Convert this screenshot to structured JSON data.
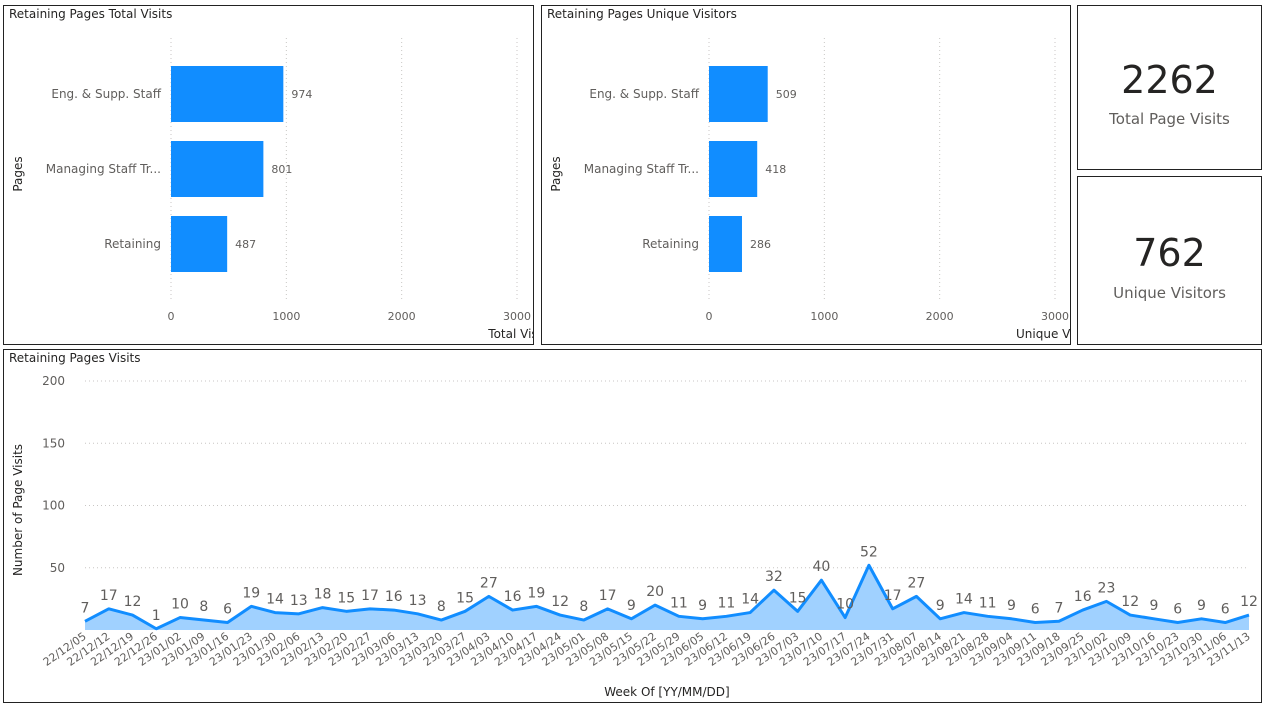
{
  "charts": [
    {
      "title": "Retaining Pages Total Visits",
      "chart_data": {
        "type": "bar",
        "orientation": "horizontal",
        "title": "Retaining Pages Total Visits",
        "categories": [
          "Eng. & Supp. Staff",
          "Managing Staff Tr...",
          "Retaining"
        ],
        "values": [
          974,
          801,
          487
        ],
        "xlabel": "Total Visit",
        "ylabel": "Pages",
        "xlim": [
          0,
          3000
        ],
        "xticks": [
          0,
          1000,
          2000,
          3000
        ],
        "bar_color": "#118DFF",
        "grid": "vertical-dotted"
      }
    },
    {
      "title": "Retaining Pages Unique Visitors",
      "chart_data": {
        "type": "bar",
        "orientation": "horizontal",
        "title": "Retaining Pages Unique Visitors",
        "categories": [
          "Eng. & Supp. Staff",
          "Managing Staff Tr...",
          "Retaining"
        ],
        "values": [
          509,
          418,
          286
        ],
        "xlabel": "Unique Visits",
        "ylabel": "Pages",
        "xlim": [
          0,
          3000
        ],
        "xticks": [
          0,
          1000,
          2000,
          3000
        ],
        "bar_color": "#118DFF",
        "grid": "vertical-dotted"
      }
    },
    {
      "title": "Retaining Pages Visits",
      "chart_data": {
        "type": "area",
        "title": "Retaining Pages Visits",
        "x": [
          "22/12/05",
          "22/12/12",
          "22/12/19",
          "22/12/26",
          "23/01/02",
          "23/01/09",
          "23/01/16",
          "23/01/23",
          "23/01/30",
          "23/02/06",
          "23/02/13",
          "23/02/20",
          "23/02/27",
          "23/03/06",
          "23/03/13",
          "23/03/20",
          "23/03/27",
          "23/04/03",
          "23/04/10",
          "23/04/17",
          "23/04/24",
          "23/05/01",
          "23/05/08",
          "23/05/15",
          "23/05/22",
          "23/05/29",
          "23/06/05",
          "23/06/12",
          "23/06/19",
          "23/06/26",
          "23/07/03",
          "23/07/10",
          "23/07/17",
          "23/07/24",
          "23/07/31",
          "23/08/07",
          "23/08/14",
          "23/08/21",
          "23/08/28",
          "23/09/04",
          "23/09/11",
          "23/09/18",
          "23/09/25",
          "23/10/02",
          "23/10/09",
          "23/10/16",
          "23/10/23",
          "23/10/30",
          "23/11/06",
          "23/11/13"
        ],
        "values": [
          7,
          17,
          12,
          1,
          10,
          8,
          6,
          19,
          14,
          13,
          18,
          15,
          17,
          16,
          13,
          8,
          15,
          27,
          16,
          19,
          12,
          8,
          17,
          9,
          20,
          11,
          9,
          11,
          14,
          32,
          15,
          40,
          10,
          52,
          17,
          27,
          9,
          14,
          11,
          9,
          6,
          7,
          16,
          23,
          12,
          9,
          6,
          9,
          6,
          12
        ],
        "xlabel": "Week Of [YY/MM/DD]",
        "ylabel": "Number of Page Visits",
        "ylim": [
          0,
          200
        ],
        "yticks": [
          50,
          100,
          150,
          200
        ],
        "line_color": "#118DFF",
        "fill_color": "#A0D1FF",
        "grid": "horizontal-dotted"
      }
    }
  ],
  "cards": [
    {
      "value": "2262",
      "label": "Total Page Visits"
    },
    {
      "value": "762",
      "label": "Unique Visitors"
    }
  ]
}
